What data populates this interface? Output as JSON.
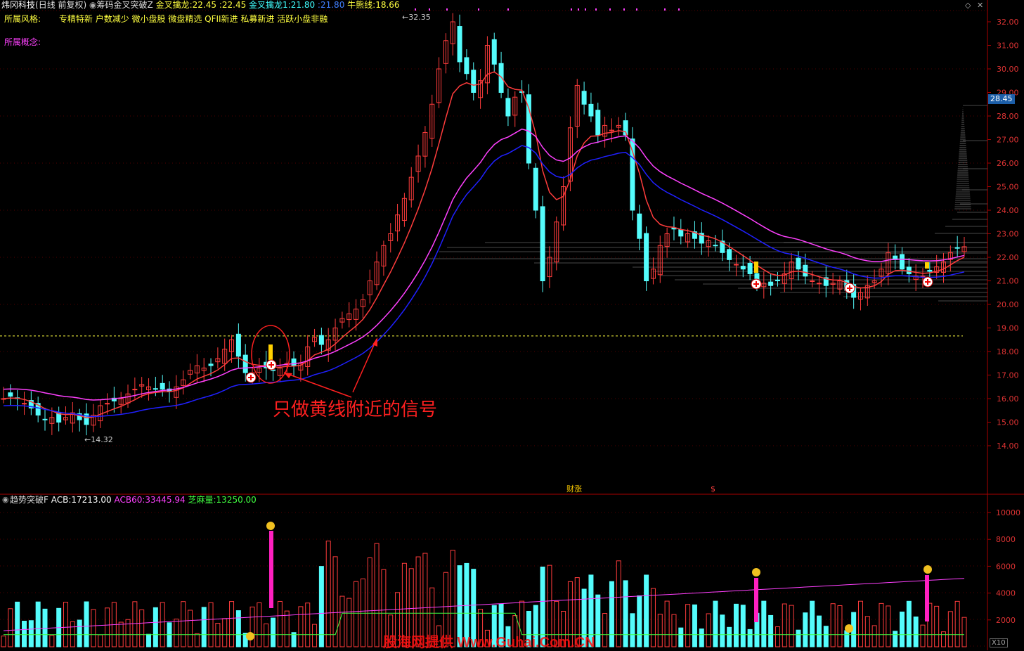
{
  "header": {
    "stock": "炜冈科技",
    "mode": "(日线 前复权)",
    "indicator": "筹码金叉突破Z",
    "items": [
      {
        "label": "金叉擒龙:",
        "value": "22.45",
        "color": "#ffff40"
      },
      {
        "label": ":",
        "value": "22.45",
        "color": "#ffff40"
      },
      {
        "label": "金叉擒龙1:",
        "value": "21.80",
        "color": "#40ffff"
      },
      {
        "label": ":",
        "value": "21.80",
        "color": "#4080ff"
      },
      {
        "label": "牛熊线:",
        "value": "18.66",
        "color": "#ffff40"
      }
    ]
  },
  "style_row": {
    "label": "所属风格:",
    "value": "专精特新 户数减少 微小盘股 微盘精选 QFII新进 私募新进 活跃小盘非融"
  },
  "concept_row": {
    "label": "所属概念:"
  },
  "chart": {
    "high_label": "32.35",
    "low_label": "14.32",
    "current_price": "28.45",
    "price_ticks": [
      "32.00",
      "31.00",
      "30.00",
      "29.00",
      "28.00",
      "27.00",
      "26.00",
      "25.00",
      "24.00",
      "23.00",
      "22.00",
      "21.00",
      "20.00",
      "19.00",
      "18.00",
      "17.00",
      "16.00",
      "15.00",
      "14.00"
    ],
    "annotation": "只做黄线附近的信号",
    "event_marker": "财涨",
    "event_marker2": "$"
  },
  "sub_panel": {
    "indicator": "趋势突破F",
    "items": [
      {
        "label": "ACB:",
        "value": "17213.00",
        "color": "#ffffff"
      },
      {
        "label": "ACB60:",
        "value": "33445.94",
        "color": "#ff40ff"
      },
      {
        "label": "芝麻量:",
        "value": "13250.00",
        "color": "#40ff40"
      }
    ],
    "ticks": [
      "10000",
      "8000",
      "6000",
      "4000",
      "2000"
    ],
    "scale": "X10"
  },
  "watermark": "股海网提供 Www.Guhai.Com.CN",
  "colors": {
    "up": "#ff3c3c",
    "down": "#54fcfc",
    "ma_magenta": "#ff40ff",
    "ma_blue": "#2020ff",
    "yellow_line": "#ffff40"
  }
}
